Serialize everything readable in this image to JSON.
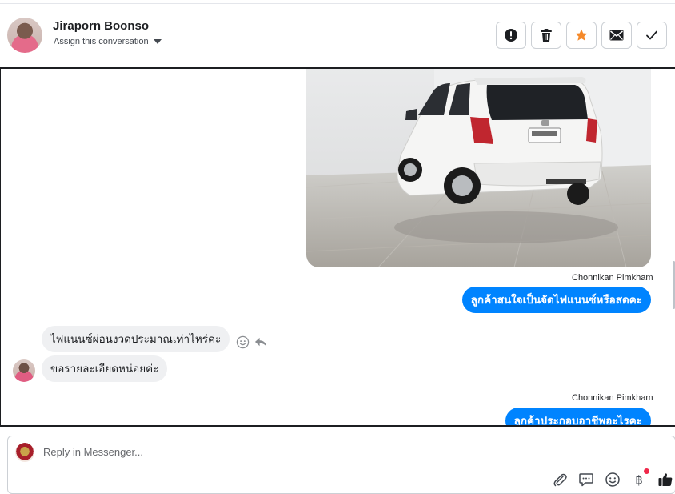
{
  "header": {
    "name": "Jiraporn Boonso",
    "assign_label": "Assign this conversation",
    "actions": [
      "mark-spam",
      "delete",
      "star",
      "mark-unread",
      "mark-done"
    ]
  },
  "colors": {
    "accent": "#0084ff",
    "star": "#f5892a",
    "incoming_bubble": "#eff0f2",
    "notification": "#f0284a"
  },
  "messages": {
    "sender_1": "Chonnikan Pimkham",
    "out_1": "ลูกค้าสนใจเป็นจัดไฟแนนซ์หรือสดคะ",
    "in_1": "ไฟแนนซ์ผ่อนงวดประมาณเท่าไหร่ค่ะ",
    "in_2": "ขอรายละเอียดหน่อยค่ะ",
    "sender_2": "Chonnikan Pimkham",
    "out_2": "ลูกค้าประกอบอาชีพอะไรคะ"
  },
  "composer": {
    "placeholder": "Reply in Messenger...",
    "value": ""
  },
  "icons": {
    "attach": "paperclip-icon",
    "saved_replies": "chat-bubble-icon",
    "emoji": "smiley-icon",
    "payment": "baht-icon",
    "like": "thumbs-up-icon"
  }
}
